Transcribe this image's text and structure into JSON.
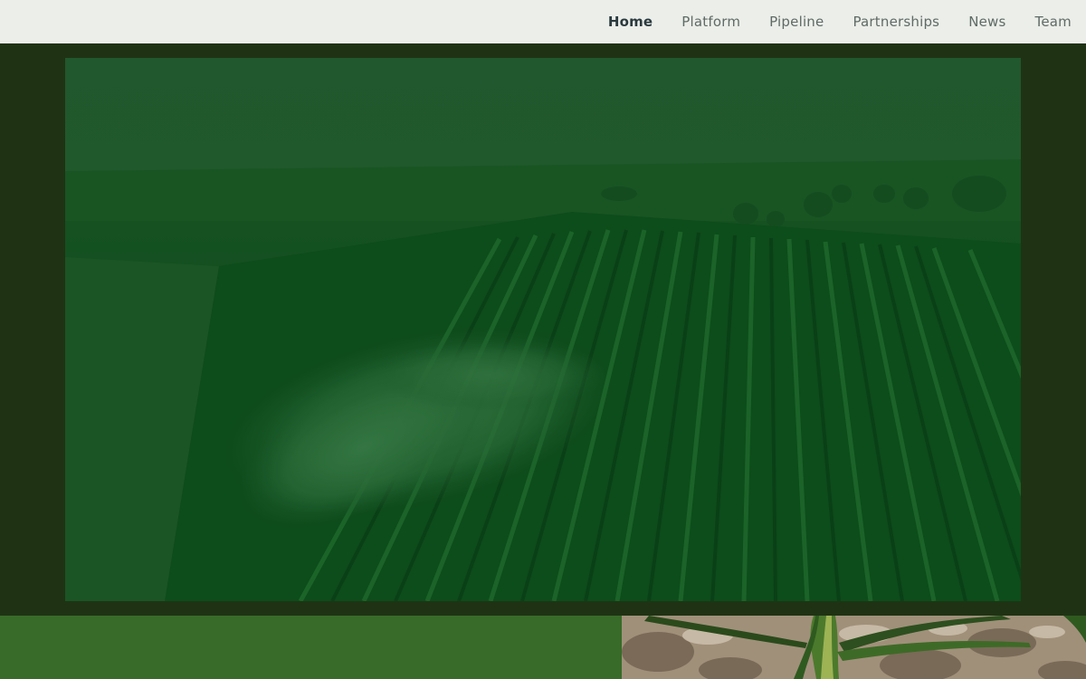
{
  "nav": {
    "items": [
      {
        "label": "Home",
        "active": true
      },
      {
        "label": "Platform",
        "active": false
      },
      {
        "label": "Pipeline",
        "active": false
      },
      {
        "label": "Partnerships",
        "active": false
      },
      {
        "label": "News",
        "active": false
      },
      {
        "label": "Team",
        "active": false
      }
    ]
  },
  "hero": {
    "image": "aerial-crop-field-irrigation-photo",
    "overlay_color": "#0f5a24"
  },
  "lower": {
    "left_panel_color": "#386b29",
    "right_image": "corn-plant-photo"
  }
}
